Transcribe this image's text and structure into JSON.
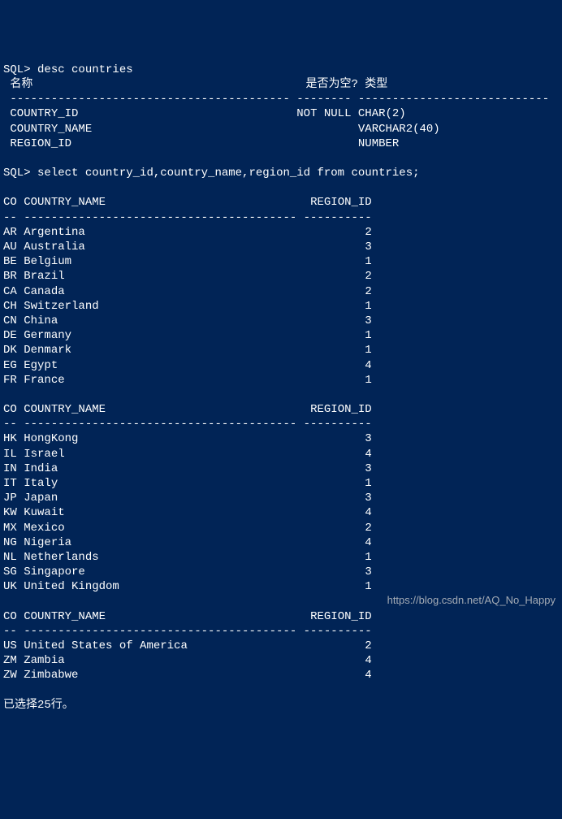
{
  "prompt": "SQL>",
  "cmd1": "desc countries",
  "desc_header": {
    "name": "名称",
    "nullable": "是否为空?",
    "type": "类型"
  },
  "desc_rows": [
    {
      "name": "COUNTRY_ID",
      "nullable": "NOT NULL",
      "type": "CHAR(2)"
    },
    {
      "name": "COUNTRY_NAME",
      "nullable": "",
      "type": "VARCHAR2(40)"
    },
    {
      "name": "REGION_ID",
      "nullable": "",
      "type": "NUMBER"
    }
  ],
  "cmd2": "select country_id,country_name,region_id from countries;",
  "result_header": {
    "co": "CO",
    "country_name": "COUNTRY_NAME",
    "region_id": "REGION_ID"
  },
  "rows_block1": [
    {
      "co": "AR",
      "name": "Argentina",
      "region": "2"
    },
    {
      "co": "AU",
      "name": "Australia",
      "region": "3"
    },
    {
      "co": "BE",
      "name": "Belgium",
      "region": "1"
    },
    {
      "co": "BR",
      "name": "Brazil",
      "region": "2"
    },
    {
      "co": "CA",
      "name": "Canada",
      "region": "2"
    },
    {
      "co": "CH",
      "name": "Switzerland",
      "region": "1"
    },
    {
      "co": "CN",
      "name": "China",
      "region": "3"
    },
    {
      "co": "DE",
      "name": "Germany",
      "region": "1"
    },
    {
      "co": "DK",
      "name": "Denmark",
      "region": "1"
    },
    {
      "co": "EG",
      "name": "Egypt",
      "region": "4"
    },
    {
      "co": "FR",
      "name": "France",
      "region": "1"
    }
  ],
  "rows_block2": [
    {
      "co": "HK",
      "name": "HongKong",
      "region": "3"
    },
    {
      "co": "IL",
      "name": "Israel",
      "region": "4"
    },
    {
      "co": "IN",
      "name": "India",
      "region": "3"
    },
    {
      "co": "IT",
      "name": "Italy",
      "region": "1"
    },
    {
      "co": "JP",
      "name": "Japan",
      "region": "3"
    },
    {
      "co": "KW",
      "name": "Kuwait",
      "region": "4"
    },
    {
      "co": "MX",
      "name": "Mexico",
      "region": "2"
    },
    {
      "co": "NG",
      "name": "Nigeria",
      "region": "4"
    },
    {
      "co": "NL",
      "name": "Netherlands",
      "region": "1"
    },
    {
      "co": "SG",
      "name": "Singapore",
      "region": "3"
    },
    {
      "co": "UK",
      "name": "United Kingdom",
      "region": "1"
    }
  ],
  "rows_block3": [
    {
      "co": "US",
      "name": "United States of America",
      "region": "2"
    },
    {
      "co": "ZM",
      "name": "Zambia",
      "region": "4"
    },
    {
      "co": "ZW",
      "name": "Zimbabwe",
      "region": "4"
    }
  ],
  "footer": "已选择25行。",
  "watermark": "https://blog.csdn.net/AQ_No_Happy",
  "divider_desc": " ----------------------------------------- -------- ----------------------------",
  "result_divider": "-- ---------------------------------------- ----------"
}
